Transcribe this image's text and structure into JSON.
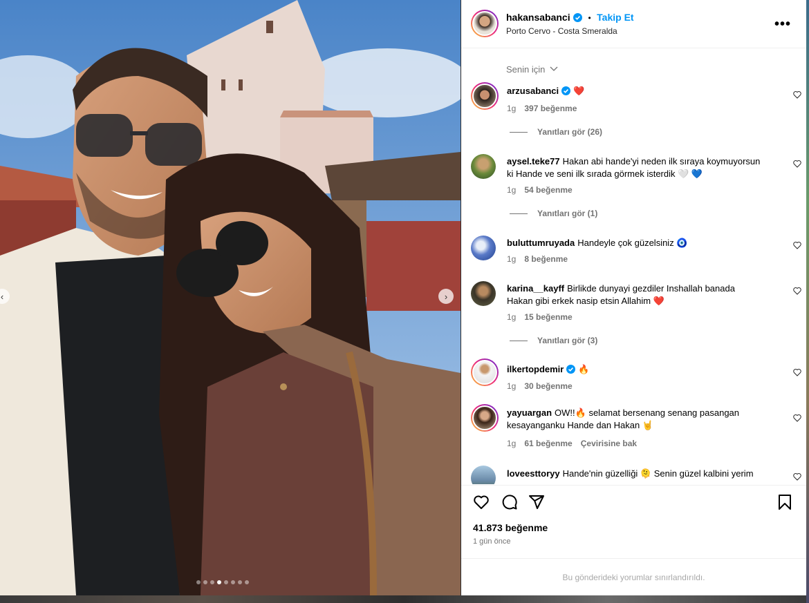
{
  "post": {
    "username": "hakansabanci",
    "separator": "•",
    "follow_label": "Takip Et",
    "location": "Porto Cervo - Costa Smeralda",
    "more_label": "•••"
  },
  "comments_section": {
    "sort_label": "Senin için",
    "comments": [
      {
        "user": "arzusabanci",
        "verified": true,
        "text": "❤️",
        "time": "1g",
        "likes": "397 beğenme",
        "replies": "Yanıtları gör (26)"
      },
      {
        "user": "aysel.teke77",
        "verified": false,
        "text": "Hakan abi hande'yi neden ilk sıraya koymuyorsun ki Hande ve seni ilk sırada görmek isterdik 🤍 💙",
        "time": "1g",
        "likes": "54 beğenme",
        "replies": "Yanıtları gör (1)"
      },
      {
        "user": "buluttumruyada",
        "verified": false,
        "text": "Handeyle çok güzelsiniz 🧿",
        "time": "1g",
        "likes": "8 beğenme"
      },
      {
        "user": "karina__kayff",
        "verified": false,
        "text": "Birlikde dunyayi gezdiler Inshallah banada Hakan gibi erkek nasip etsin Allahim ❤️",
        "time": "1g",
        "likes": "15 beğenme",
        "replies": "Yanıtları gör (3)"
      },
      {
        "user": "ilkertopdemir",
        "verified": true,
        "text": "🔥",
        "time": "1g",
        "likes": "30 beğenme"
      },
      {
        "user": "yayuargan",
        "verified": false,
        "text": "OW!!🔥 selamat bersenang senang pasangan kesayanganku Hande dan Hakan 🤘",
        "time": "1g",
        "likes": "61 beğenme",
        "translate": "Çevirisine bak"
      },
      {
        "user": "loveesttoryy",
        "verified": false,
        "text": "Hande'nin güzelliği 🫠 Senin güzel kalbini yerim",
        "time": "",
        "likes": ""
      }
    ]
  },
  "footer": {
    "likes": "41.873 beğenme",
    "time": "1 gün önce",
    "limited_notice": "Bu gönderideki yorumlar sınırlandırıldı."
  },
  "media": {
    "prev_label": "‹",
    "next_label": "›",
    "dot_count": 8,
    "active_dot": 3
  },
  "colors": {
    "link_blue": "#0095f6",
    "heart_red": "#ed4956",
    "verified_blue": "#0095f6"
  }
}
